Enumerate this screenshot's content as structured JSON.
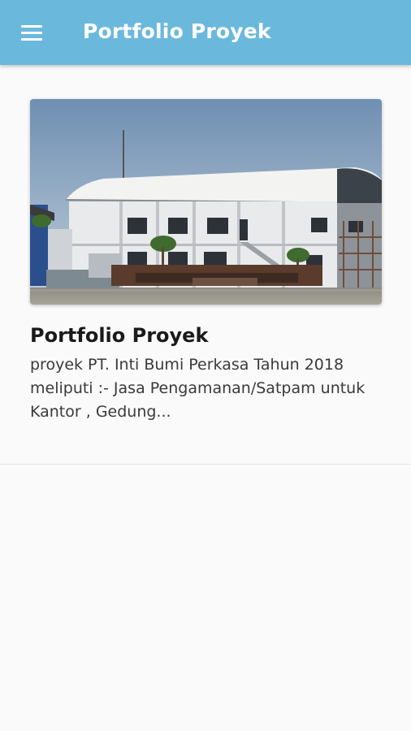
{
  "appbar": {
    "menu_icon": "hamburger-menu-icon",
    "title": "Portfolio Proyek",
    "color": "#6bb8dd"
  },
  "card": {
    "title": "Portfolio Proyek",
    "description": "proyek PT. Inti Bumi Perkasa Tahun 2018 meliputi :- Jasa Pengamanan/Satpam untuk Kantor , Gedung..."
  }
}
